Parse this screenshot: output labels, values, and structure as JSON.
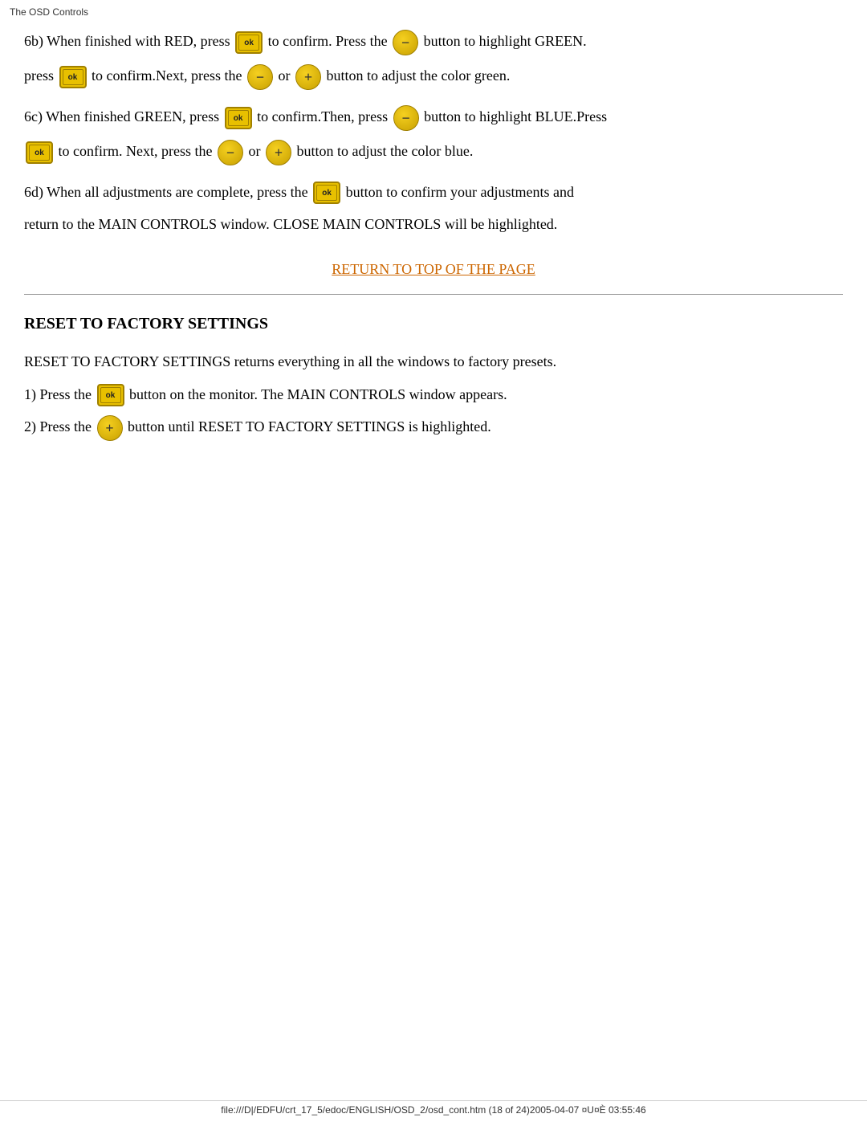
{
  "title_bar": {
    "text": "The OSD Controls"
  },
  "section_6b": {
    "line1": "6b) When finished with RED, press",
    "line1_mid": "to confirm. Press the",
    "line1_end": "button to highlight GREEN.",
    "line2_start": "press",
    "line2_mid": "to confirm.Next, press the",
    "line2_or": "or",
    "line2_end": "button to adjust the color green."
  },
  "section_6c": {
    "line1": "6c) When finished GREEN, press",
    "line1_mid": "to confirm.Then, press",
    "line1_end": "button to highlight BLUE.Press",
    "line2_start": "to confirm. Next, press the",
    "line2_or": "or",
    "line2_end": "button to adjust the color blue."
  },
  "section_6d": {
    "line1": "6d) When all adjustments are complete, press the",
    "line1_end": "button to confirm your adjustments and",
    "line2": "return to the MAIN CONTROLS window. CLOSE MAIN CONTROLS will be highlighted."
  },
  "return_link": {
    "text": "RETURN TO TOP OF THE PAGE"
  },
  "reset_section": {
    "title": "RESET TO FACTORY SETTINGS",
    "intro": "RESET TO FACTORY SETTINGS returns everything in all the windows to factory presets.",
    "step1_start": "1) Press the",
    "step1_end": "button on the monitor. The MAIN CONTROLS window appears.",
    "step2_start": "2) Press the",
    "step2_end": "button until RESET TO FACTORY SETTINGS is highlighted."
  },
  "footer": {
    "text": "file:///D|/EDFU/crt_17_5/edoc/ENGLISH/OSD_2/osd_cont.htm (18 of 24)2005-04-07 ¤U¤È 03:55:46"
  },
  "buttons": {
    "ok_label": "ok",
    "minus_label": "−",
    "plus_label": "+"
  }
}
